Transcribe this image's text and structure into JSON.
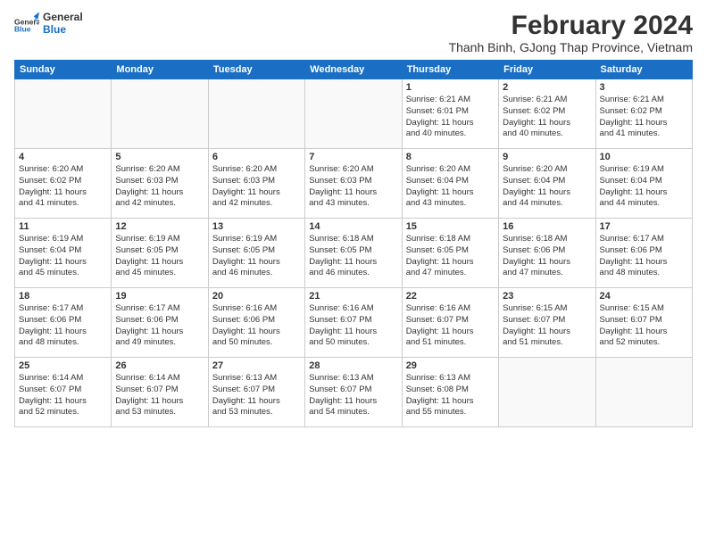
{
  "logo": {
    "line1": "General",
    "line2": "Blue"
  },
  "title": "February 2024",
  "subtitle": "Thanh Binh, GJong Thap Province, Vietnam",
  "days_header": [
    "Sunday",
    "Monday",
    "Tuesday",
    "Wednesday",
    "Thursday",
    "Friday",
    "Saturday"
  ],
  "weeks": [
    [
      {
        "day": "",
        "info": ""
      },
      {
        "day": "",
        "info": ""
      },
      {
        "day": "",
        "info": ""
      },
      {
        "day": "",
        "info": ""
      },
      {
        "day": "1",
        "info": "Sunrise: 6:21 AM\nSunset: 6:01 PM\nDaylight: 11 hours\nand 40 minutes."
      },
      {
        "day": "2",
        "info": "Sunrise: 6:21 AM\nSunset: 6:02 PM\nDaylight: 11 hours\nand 40 minutes."
      },
      {
        "day": "3",
        "info": "Sunrise: 6:21 AM\nSunset: 6:02 PM\nDaylight: 11 hours\nand 41 minutes."
      }
    ],
    [
      {
        "day": "4",
        "info": "Sunrise: 6:20 AM\nSunset: 6:02 PM\nDaylight: 11 hours\nand 41 minutes."
      },
      {
        "day": "5",
        "info": "Sunrise: 6:20 AM\nSunset: 6:03 PM\nDaylight: 11 hours\nand 42 minutes."
      },
      {
        "day": "6",
        "info": "Sunrise: 6:20 AM\nSunset: 6:03 PM\nDaylight: 11 hours\nand 42 minutes."
      },
      {
        "day": "7",
        "info": "Sunrise: 6:20 AM\nSunset: 6:03 PM\nDaylight: 11 hours\nand 43 minutes."
      },
      {
        "day": "8",
        "info": "Sunrise: 6:20 AM\nSunset: 6:04 PM\nDaylight: 11 hours\nand 43 minutes."
      },
      {
        "day": "9",
        "info": "Sunrise: 6:20 AM\nSunset: 6:04 PM\nDaylight: 11 hours\nand 44 minutes."
      },
      {
        "day": "10",
        "info": "Sunrise: 6:19 AM\nSunset: 6:04 PM\nDaylight: 11 hours\nand 44 minutes."
      }
    ],
    [
      {
        "day": "11",
        "info": "Sunrise: 6:19 AM\nSunset: 6:04 PM\nDaylight: 11 hours\nand 45 minutes."
      },
      {
        "day": "12",
        "info": "Sunrise: 6:19 AM\nSunset: 6:05 PM\nDaylight: 11 hours\nand 45 minutes."
      },
      {
        "day": "13",
        "info": "Sunrise: 6:19 AM\nSunset: 6:05 PM\nDaylight: 11 hours\nand 46 minutes."
      },
      {
        "day": "14",
        "info": "Sunrise: 6:18 AM\nSunset: 6:05 PM\nDaylight: 11 hours\nand 46 minutes."
      },
      {
        "day": "15",
        "info": "Sunrise: 6:18 AM\nSunset: 6:05 PM\nDaylight: 11 hours\nand 47 minutes."
      },
      {
        "day": "16",
        "info": "Sunrise: 6:18 AM\nSunset: 6:06 PM\nDaylight: 11 hours\nand 47 minutes."
      },
      {
        "day": "17",
        "info": "Sunrise: 6:17 AM\nSunset: 6:06 PM\nDaylight: 11 hours\nand 48 minutes."
      }
    ],
    [
      {
        "day": "18",
        "info": "Sunrise: 6:17 AM\nSunset: 6:06 PM\nDaylight: 11 hours\nand 48 minutes."
      },
      {
        "day": "19",
        "info": "Sunrise: 6:17 AM\nSunset: 6:06 PM\nDaylight: 11 hours\nand 49 minutes."
      },
      {
        "day": "20",
        "info": "Sunrise: 6:16 AM\nSunset: 6:06 PM\nDaylight: 11 hours\nand 50 minutes."
      },
      {
        "day": "21",
        "info": "Sunrise: 6:16 AM\nSunset: 6:07 PM\nDaylight: 11 hours\nand 50 minutes."
      },
      {
        "day": "22",
        "info": "Sunrise: 6:16 AM\nSunset: 6:07 PM\nDaylight: 11 hours\nand 51 minutes."
      },
      {
        "day": "23",
        "info": "Sunrise: 6:15 AM\nSunset: 6:07 PM\nDaylight: 11 hours\nand 51 minutes."
      },
      {
        "day": "24",
        "info": "Sunrise: 6:15 AM\nSunset: 6:07 PM\nDaylight: 11 hours\nand 52 minutes."
      }
    ],
    [
      {
        "day": "25",
        "info": "Sunrise: 6:14 AM\nSunset: 6:07 PM\nDaylight: 11 hours\nand 52 minutes."
      },
      {
        "day": "26",
        "info": "Sunrise: 6:14 AM\nSunset: 6:07 PM\nDaylight: 11 hours\nand 53 minutes."
      },
      {
        "day": "27",
        "info": "Sunrise: 6:13 AM\nSunset: 6:07 PM\nDaylight: 11 hours\nand 53 minutes."
      },
      {
        "day": "28",
        "info": "Sunrise: 6:13 AM\nSunset: 6:07 PM\nDaylight: 11 hours\nand 54 minutes."
      },
      {
        "day": "29",
        "info": "Sunrise: 6:13 AM\nSunset: 6:08 PM\nDaylight: 11 hours\nand 55 minutes."
      },
      {
        "day": "",
        "info": ""
      },
      {
        "day": "",
        "info": ""
      }
    ]
  ]
}
